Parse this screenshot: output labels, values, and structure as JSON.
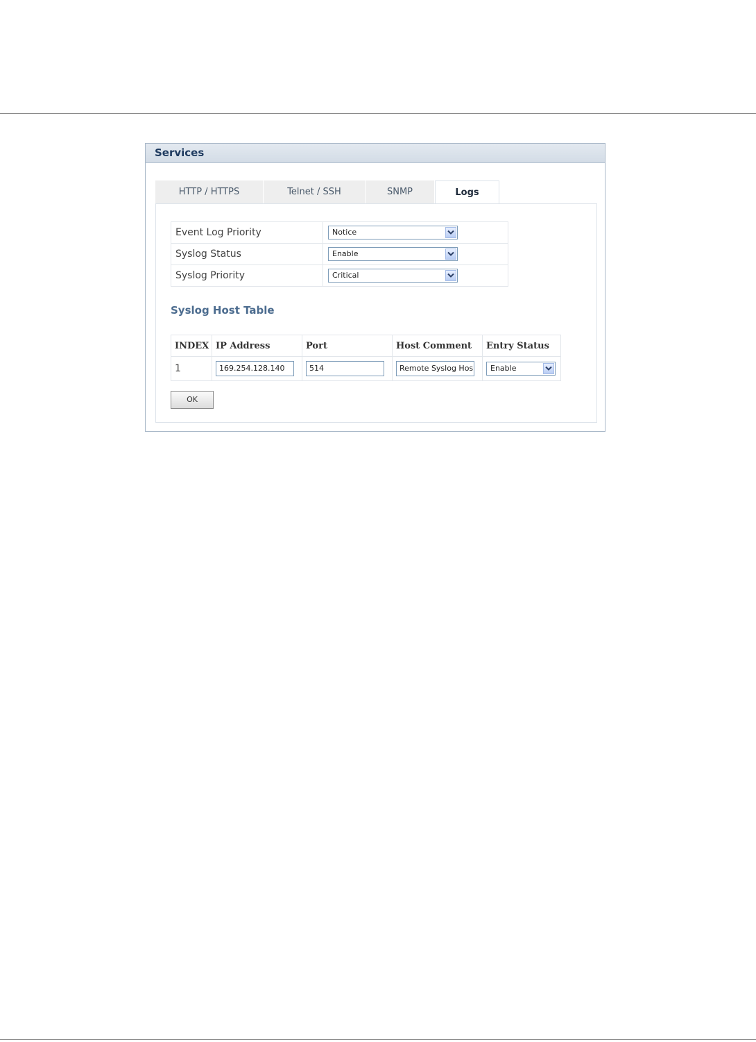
{
  "panel": {
    "title": "Services"
  },
  "tabs": [
    {
      "label": "HTTP / HTTPS",
      "active": false
    },
    {
      "label": "Telnet / SSH",
      "active": false
    },
    {
      "label": "SNMP",
      "active": false
    },
    {
      "label": "Logs",
      "active": true
    }
  ],
  "settings": [
    {
      "label": "Event Log Priority",
      "value": "Notice"
    },
    {
      "label": "Syslog Status",
      "value": "Enable"
    },
    {
      "label": "Syslog Priority",
      "value": "Critical"
    }
  ],
  "host_table": {
    "title": "Syslog Host Table",
    "columns": [
      "INDEX",
      "IP Address",
      "Port",
      "Host Comment",
      "Entry Status"
    ],
    "rows": [
      {
        "index": "1",
        "ip": "169.254.128.140",
        "port": "514",
        "comment": "Remote Syslog Hos",
        "status": "Enable"
      }
    ]
  },
  "buttons": {
    "ok_label": "OK"
  },
  "icons": {
    "dropdown": "chevron-down-icon"
  },
  "colors": {
    "header_text": "#1e3a5f",
    "section_title": "#4c6c8f",
    "input_border": "#7f9db9"
  }
}
